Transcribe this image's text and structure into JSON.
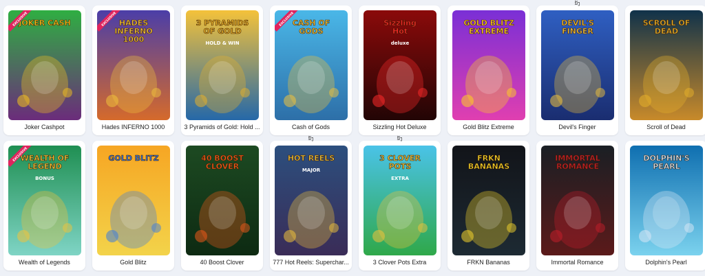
{
  "games": [
    {
      "title": "Joker Cashpot",
      "logo": "JOKER CASH",
      "badge": "EXCLUSIVE",
      "tag": "",
      "bg1": "#2fae42",
      "bg2": "#6b2c7b",
      "accent": "#f6c21c"
    },
    {
      "title": "Hades INFERNO 1000",
      "logo": "HADES INFERNO 1000",
      "badge": "EXCLUSIVE",
      "tag": "",
      "bg1": "#4b3ea8",
      "bg2": "#d56a2b",
      "accent": "#f0c33b"
    },
    {
      "title": "3 Pyramids of Gold: Hold ...",
      "logo": "3 PYRAMIDS OF GOLD",
      "sublogo": "HOLD & WIN",
      "badge": "",
      "tag": "",
      "bg1": "#f4c23a",
      "bg2": "#2568a8",
      "accent": "#e8b12a"
    },
    {
      "title": "Cash of Gods",
      "logo": "CASH OF GODS",
      "badge": "EXCLUSIVE",
      "tag": "",
      "bg1": "#4ab7e8",
      "bg2": "#2d6fa8",
      "accent": "#f2c33a"
    },
    {
      "title": "Sizzling Hot Deluxe",
      "logo": "Sizzling Hot",
      "sublogo": "deluxe",
      "badge": "",
      "tag": "",
      "bg1": "#8b0a0a",
      "bg2": "#220505",
      "accent": "#ff2a2a"
    },
    {
      "title": "Gold Blitz Extreme",
      "logo": "GOLD BLITZ EXTREME",
      "badge": "",
      "tag": "",
      "bg1": "#7a2fd6",
      "bg2": "#e03fb0",
      "accent": "#ffd21f"
    },
    {
      "title": "Devil's Finger",
      "logo": "DEVIL'S FINGER",
      "badge": "",
      "tag": "ນັງ",
      "bg1": "#2f5fc2",
      "bg2": "#1a2d70",
      "accent": "#f2c33a"
    },
    {
      "title": "Scroll of Dead",
      "logo": "SCROLL OF DEAD",
      "badge": "",
      "tag": "",
      "bg1": "#10324a",
      "bg2": "#c88a2a",
      "accent": "#e8b12a"
    },
    {
      "title": "Wealth of Legends",
      "logo": "WEALTH OF LEGEND",
      "sublogo": "BONUS",
      "badge": "EXCLUSIVE",
      "tag": "",
      "bg1": "#1f8f52",
      "bg2": "#7fd4c5",
      "accent": "#f2c33a"
    },
    {
      "title": "Gold Blitz",
      "logo": "GOLD BLITZ",
      "badge": "",
      "tag": "",
      "bg1": "#f6a623",
      "bg2": "#f3d34a",
      "accent": "#3b7be0"
    },
    {
      "title": "40 Boost Clover",
      "logo": "40 BOOST CLOVER",
      "badge": "",
      "tag": "",
      "bg1": "#1d4a22",
      "bg2": "#0d2a12",
      "accent": "#f25a1a"
    },
    {
      "title": "777 Hot Reels: Superchar...",
      "logo": "HOT REELS",
      "sublogo": "MAJOR",
      "badge": "",
      "tag": "ນັງ",
      "bg1": "#2c4f7e",
      "bg2": "#3a2c57",
      "accent": "#f2c33a"
    },
    {
      "title": "3 Clover Pots Extra",
      "logo": "3 CLOVER POTS",
      "sublogo": "EXTRA",
      "badge": "",
      "tag": "ນັງ",
      "bg1": "#4ac3e8",
      "bg2": "#2fa84a",
      "accent": "#f2c33a"
    },
    {
      "title": "FRKN Bananas",
      "logo": "FRKN BANANAS",
      "badge": "",
      "tag": "",
      "bg1": "#121419",
      "bg2": "#1d2a33",
      "accent": "#f6d62c"
    },
    {
      "title": "Immortal Romance",
      "logo": "IMMORTAL ROMANCE",
      "badge": "",
      "tag": "",
      "bg1": "#1a1f24",
      "bg2": "#5b1a1a",
      "accent": "#c21e2a"
    },
    {
      "title": "Dolphin's Pearl",
      "logo": "DOLPHIN'S PEARL",
      "badge": "",
      "tag": "",
      "bg1": "#0f6fb0",
      "bg2": "#7bd2ee",
      "accent": "#d9e8f5"
    }
  ]
}
